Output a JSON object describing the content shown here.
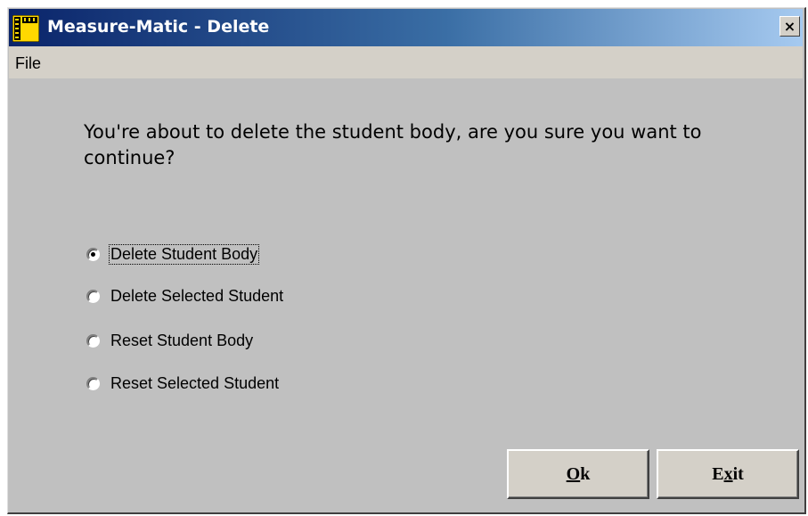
{
  "window": {
    "title": "Measure-Matic - Delete",
    "close_label": "×"
  },
  "menu": {
    "items": [
      {
        "label": "File"
      }
    ]
  },
  "prompt": "You're about to delete the student body, are you sure you want to continue?",
  "options": [
    {
      "label": "Delete Student Body",
      "checked": true
    },
    {
      "label": "Delete Selected Student",
      "checked": false
    },
    {
      "label": "Reset Student Body",
      "checked": false
    },
    {
      "label": "Reset Selected Student",
      "checked": false
    }
  ],
  "buttons": {
    "ok": {
      "label_before": "",
      "mnemonic": "O",
      "label_after": "k"
    },
    "exit": {
      "label_before": "E",
      "mnemonic": "x",
      "label_after": "it"
    }
  },
  "colors": {
    "titlebar_start": "#0a246a",
    "titlebar_end": "#a6caf0",
    "window_bg": "#c0c0c0",
    "button_face": "#d4d0c8"
  },
  "icons": {
    "app": "ruler-app-icon",
    "close": "close-icon"
  }
}
